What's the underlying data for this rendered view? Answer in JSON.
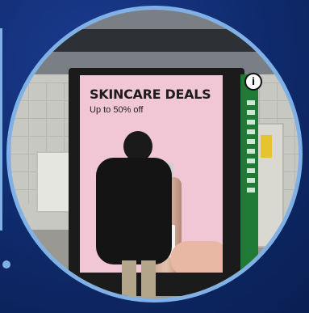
{
  "ad": {
    "headline": "SKINCARE DEALS",
    "subheadline": "Up to 50% off",
    "info_symbol": "i"
  },
  "colors": {
    "background": "#0f2a6b",
    "ring": "#7fb0e6",
    "ad_screen": "#f2c7d5",
    "side_panel": "#1f7a35"
  }
}
